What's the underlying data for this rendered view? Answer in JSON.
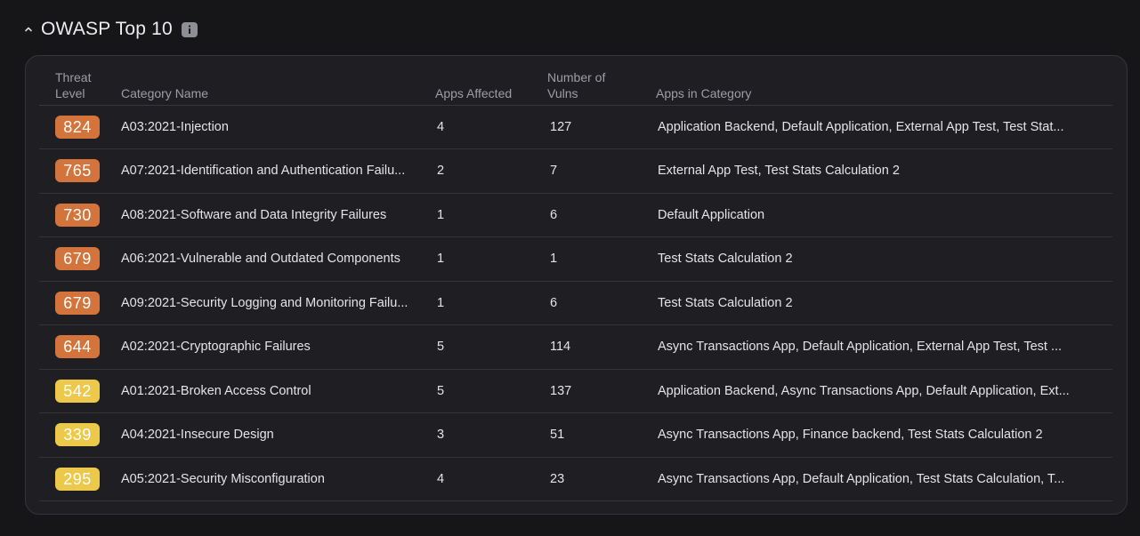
{
  "section": {
    "title": "OWASP Top 10",
    "info_icon": "info-icon",
    "collapse_icon": "chevron-up-icon"
  },
  "colors": {
    "high": "#d4743d",
    "medium": "#ecc94b"
  },
  "table": {
    "headers": {
      "threat_level": "Threat\nLevel",
      "category_name": "Category Name",
      "apps_affected": "Apps Affected",
      "number_of_vulns": "Number of\nVulns",
      "apps_in_category": "Apps in Category"
    },
    "rows": [
      {
        "threat": "824",
        "severity": "high",
        "category": "A03:2021-Injection",
        "apps_affected": "4",
        "vulns": "127",
        "apps": "Application Backend, Default Application, External App Test, Test Stat..."
      },
      {
        "threat": "765",
        "severity": "high",
        "category": "A07:2021-Identification and Authentication Failu...",
        "apps_affected": "2",
        "vulns": "7",
        "apps": "External App Test, Test Stats Calculation 2"
      },
      {
        "threat": "730",
        "severity": "high",
        "category": "A08:2021-Software and Data Integrity Failures",
        "apps_affected": "1",
        "vulns": "6",
        "apps": "Default Application"
      },
      {
        "threat": "679",
        "severity": "high",
        "category": "A06:2021-Vulnerable and Outdated Components",
        "apps_affected": "1",
        "vulns": "1",
        "apps": "Test Stats Calculation 2"
      },
      {
        "threat": "679",
        "severity": "high",
        "category": "A09:2021-Security Logging and Monitoring Failu...",
        "apps_affected": "1",
        "vulns": "6",
        "apps": "Test Stats Calculation 2"
      },
      {
        "threat": "644",
        "severity": "high",
        "category": "A02:2021-Cryptographic Failures",
        "apps_affected": "5",
        "vulns": "114",
        "apps": "Async Transactions App, Default Application, External App Test, Test ..."
      },
      {
        "threat": "542",
        "severity": "medium",
        "category": "A01:2021-Broken Access Control",
        "apps_affected": "5",
        "vulns": "137",
        "apps": "Application Backend, Async Transactions App, Default Application, Ext..."
      },
      {
        "threat": "339",
        "severity": "medium",
        "category": "A04:2021-Insecure Design",
        "apps_affected": "3",
        "vulns": "51",
        "apps": "Async Transactions App, Finance backend, Test Stats Calculation 2"
      },
      {
        "threat": "295",
        "severity": "medium",
        "category": "A05:2021-Security Misconfiguration",
        "apps_affected": "4",
        "vulns": "23",
        "apps": "Async Transactions App, Default Application, Test Stats Calculation, T..."
      }
    ]
  }
}
